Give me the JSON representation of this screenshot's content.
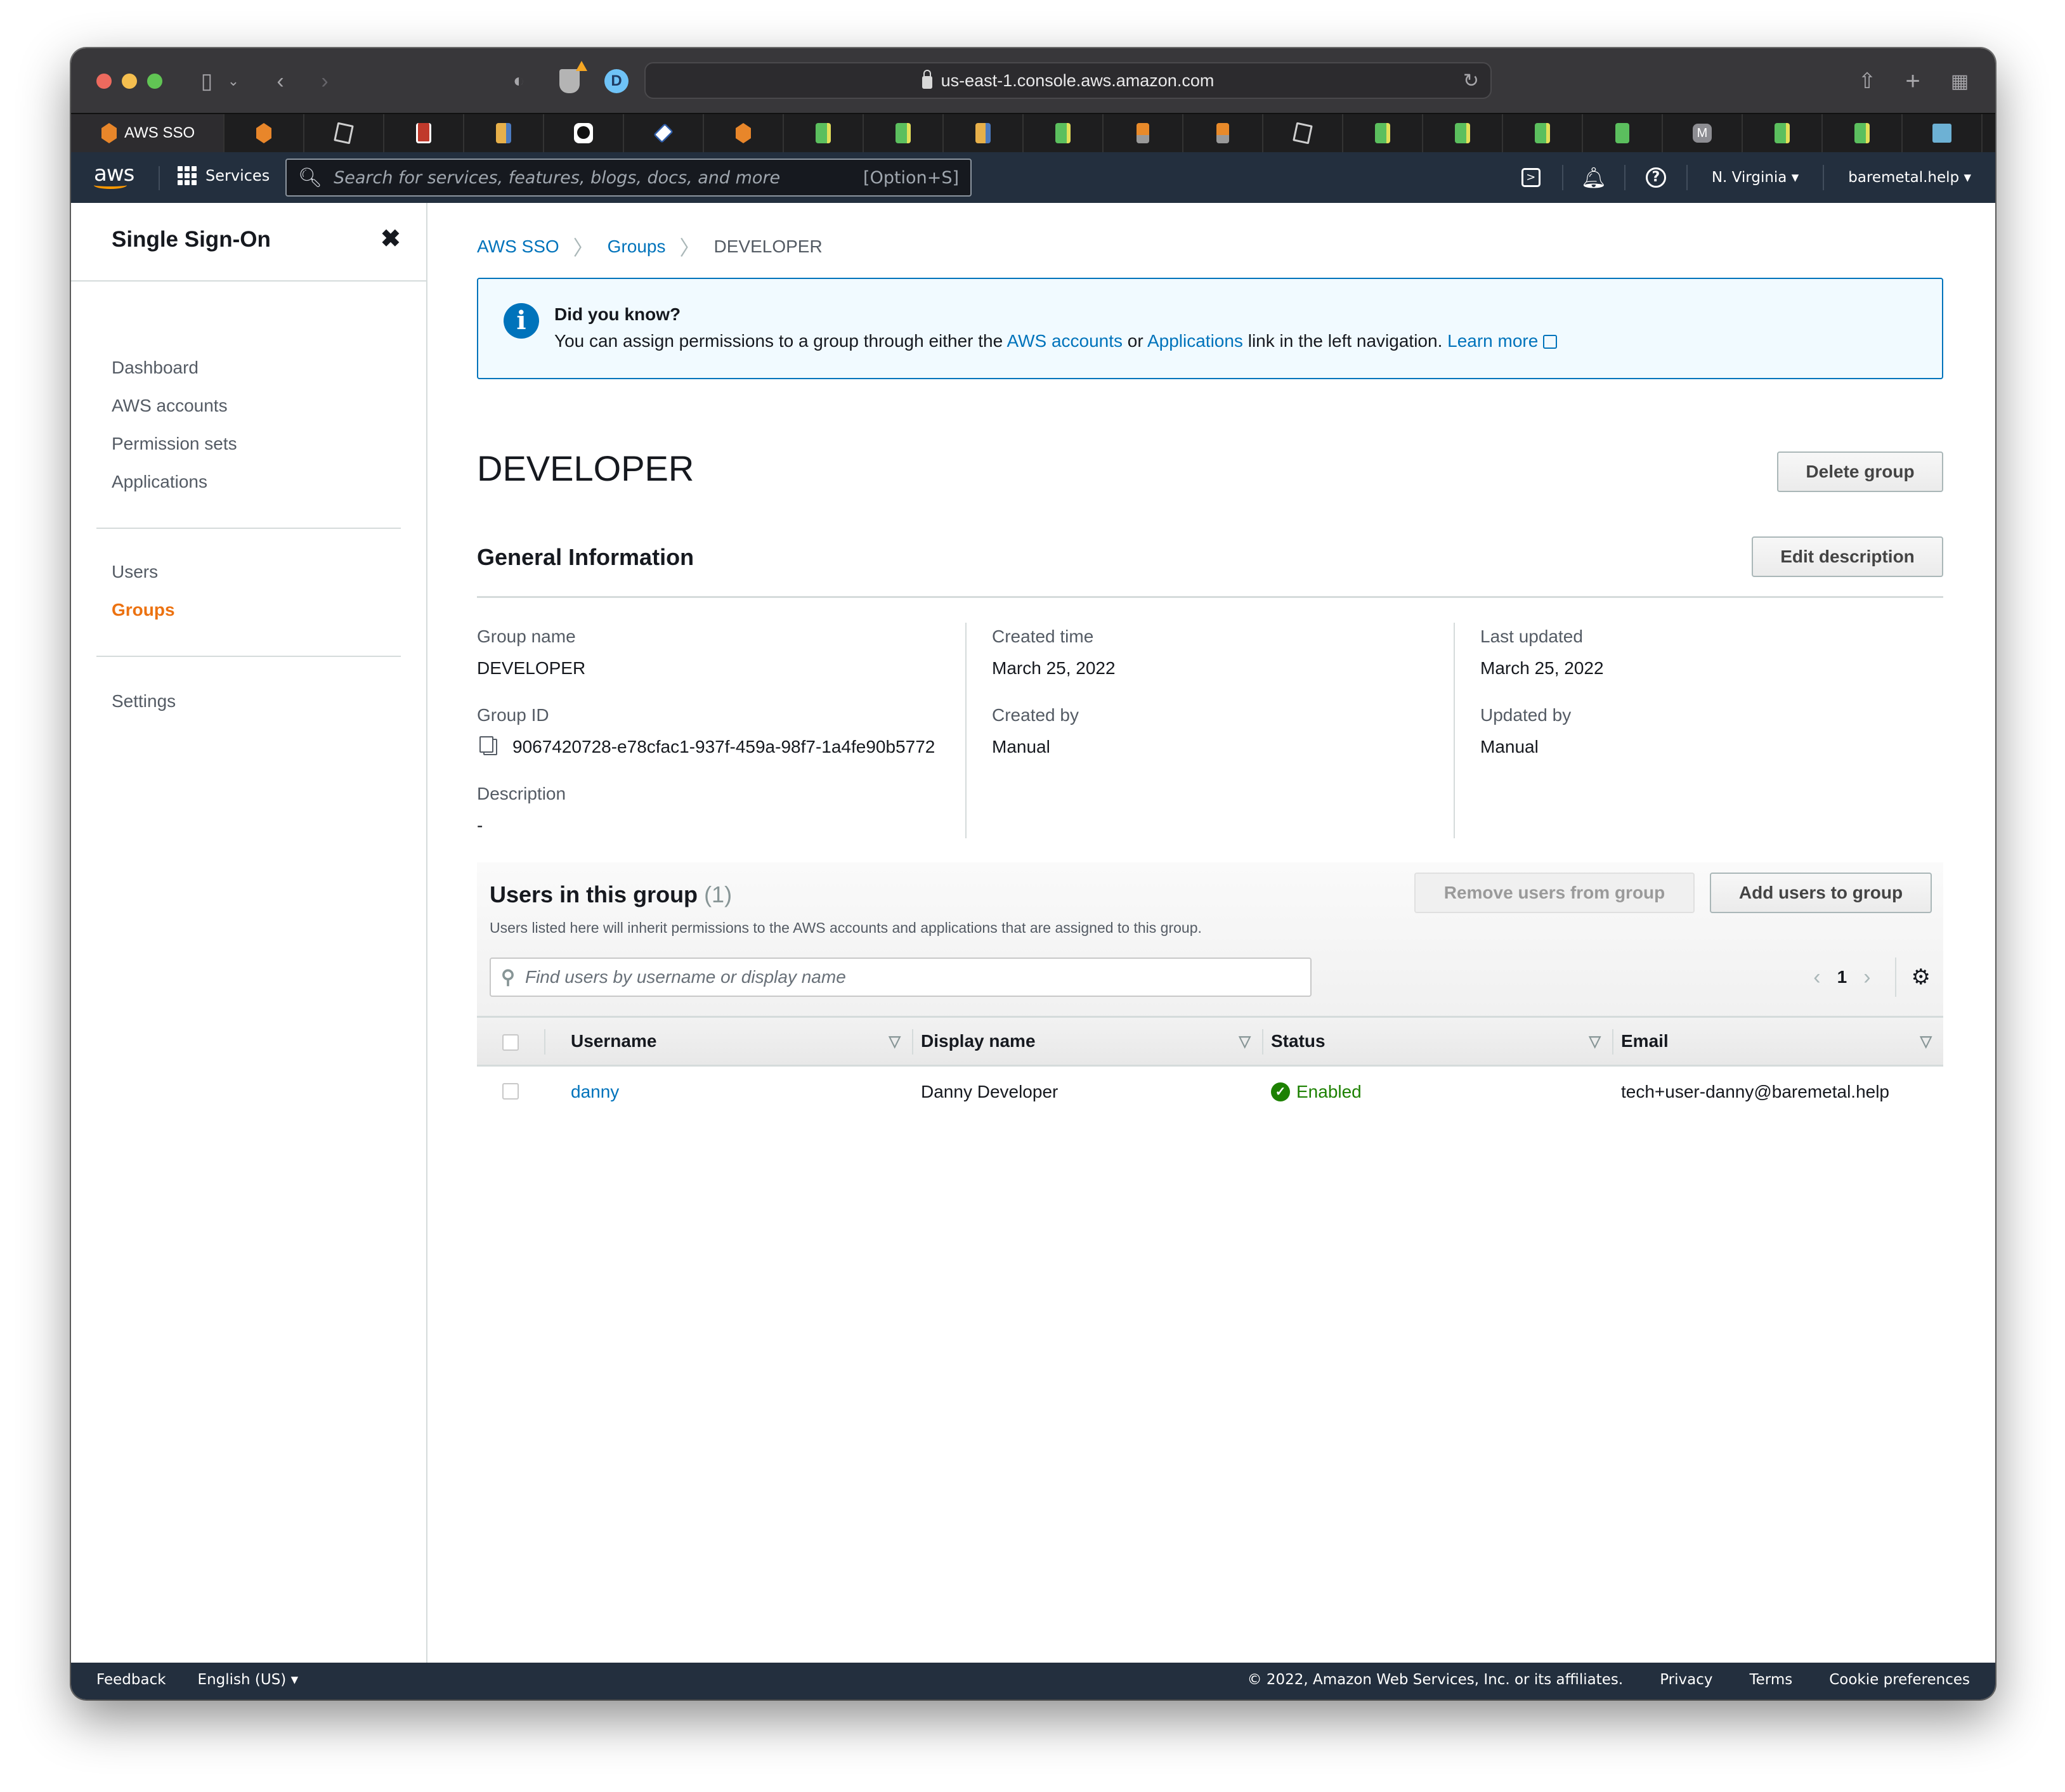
{
  "browser": {
    "url": "us-east-1.console.aws.amazon.com",
    "active_tab": "AWS SSO",
    "tab_favicons": [
      "aws-orange-icon",
      "cube-icon",
      "red-n-icon",
      "book-icon",
      "github-icon",
      "help-diamond-icon",
      "aws-orange-icon",
      "evernote-green-icon",
      "evernote-green-icon",
      "book-icon",
      "evernote-green-icon",
      "stackoverflow-icon",
      "stackoverflow-icon",
      "cube-icon",
      "evernote-green-icon",
      "evernote-green-icon",
      "evernote-green-icon",
      "green-plain-icon",
      "m-icon",
      "evernote-green-icon",
      "evernote-green-icon",
      "markdown-icon"
    ],
    "m_glyph": "M"
  },
  "awsnav": {
    "logo": "aws",
    "services_label": "Services",
    "search_placeholder": "Search for services, features, blogs, docs, and more",
    "search_shortcut": "[Option+S]",
    "region": "N. Virginia ▾",
    "account": "baremetal.help ▾"
  },
  "sidebar": {
    "title": "Single Sign-On",
    "close_glyph": "✖",
    "items": [
      {
        "label": "Dashboard",
        "active": false
      },
      {
        "label": "AWS accounts",
        "active": false
      },
      {
        "label": "Permission sets",
        "active": false
      },
      {
        "label": "Applications",
        "active": false
      },
      {
        "label": "Users",
        "active": false
      },
      {
        "label": "Groups",
        "active": true
      },
      {
        "label": "Settings",
        "active": false
      }
    ]
  },
  "breadcrumb": {
    "items": [
      "AWS SSO",
      "Groups",
      "DEVELOPER"
    ],
    "sep": "〉"
  },
  "flash": {
    "title": "Did you know?",
    "text_before": "You can assign permissions to a group through either the ",
    "link1": "AWS accounts",
    "text_mid": " or ",
    "link2": "Applications",
    "text_after": " link in the left navigation. ",
    "learn_more": "Learn more"
  },
  "page": {
    "title": "DEVELOPER",
    "delete_button": "Delete group"
  },
  "general": {
    "heading": "General Information",
    "edit_button": "Edit description",
    "fields": {
      "group_name": {
        "label": "Group name",
        "value": "DEVELOPER"
      },
      "group_id": {
        "label": "Group ID",
        "value": "9067420728-e78cfac1-937f-459a-98f7-1a4fe90b5772"
      },
      "description": {
        "label": "Description",
        "value": "-"
      },
      "created_time": {
        "label": "Created time",
        "value": "March 25, 2022"
      },
      "created_by": {
        "label": "Created by",
        "value": "Manual"
      },
      "last_updated": {
        "label": "Last updated",
        "value": "March 25, 2022"
      },
      "updated_by": {
        "label": "Updated by",
        "value": "Manual"
      }
    }
  },
  "users": {
    "heading": "Users in this group",
    "count": "(1)",
    "subtitle": "Users listed here will inherit permissions to the AWS accounts and applications that are assigned to this group.",
    "remove_button": "Remove users from group",
    "add_button": "Add users to group",
    "search_placeholder": "Find users by username or display name",
    "page": "1",
    "columns": [
      "Username",
      "Display name",
      "Status",
      "Email"
    ],
    "rows": [
      {
        "username": "danny",
        "display_name": "Danny Developer",
        "status": "Enabled",
        "email": "tech+user-danny@baremetal.help"
      }
    ]
  },
  "footer": {
    "feedback": "Feedback",
    "language": "English (US) ▾",
    "copyright": "© 2022, Amazon Web Services, Inc. or its affiliates.",
    "privacy": "Privacy",
    "terms": "Terms",
    "cookies": "Cookie preferences"
  }
}
